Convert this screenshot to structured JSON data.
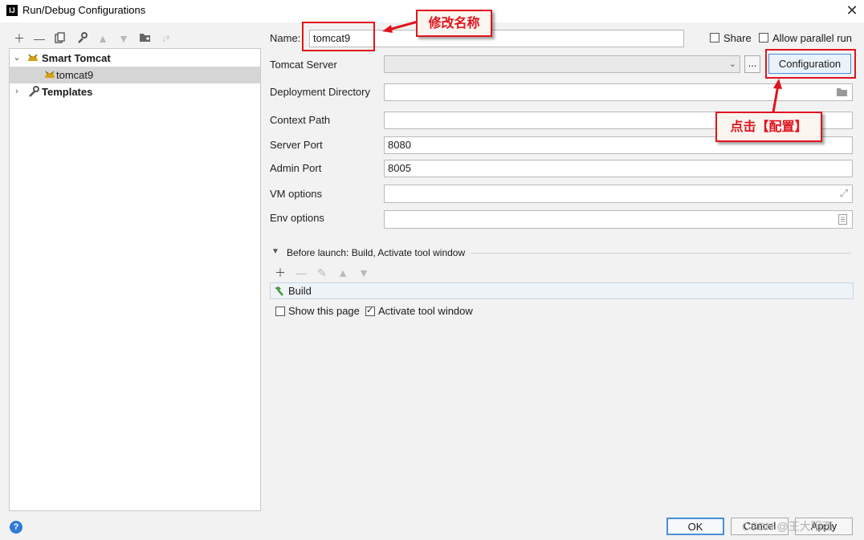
{
  "window": {
    "title": "Run/Debug Configurations",
    "app_icon": "IJ"
  },
  "tree": {
    "items": [
      {
        "label": "Smart Tomcat"
      },
      {
        "label": "tomcat9"
      },
      {
        "label": "Templates"
      }
    ]
  },
  "form": {
    "name_label": "Name:",
    "name_value": "tomcat9",
    "share_label": "Share",
    "parallel_label": "Allow parallel run",
    "tomcat_server_label": "Tomcat Server",
    "ellipsis_label": "...",
    "configuration_button": "Configuration",
    "deploy_label": "Deployment Directory",
    "context_label": "Context Path",
    "server_port_label": "Server Port",
    "server_port_value": "8080",
    "admin_port_label": "Admin Port",
    "admin_port_value": "8005",
    "vm_label": "VM options",
    "env_label": "Env options"
  },
  "before_launch": {
    "header": "Before launch: Build, Activate tool window",
    "task": "Build",
    "show_page_label": "Show this page",
    "activate_label": "Activate tool window"
  },
  "buttons": {
    "ok": "OK",
    "cancel": "Cancel",
    "apply": "Apply"
  },
  "annotations": {
    "rename": "修改名称",
    "click_config": "点击【配置】",
    "accent": "#e0141e"
  },
  "watermark": "CSDN @王大阳西"
}
